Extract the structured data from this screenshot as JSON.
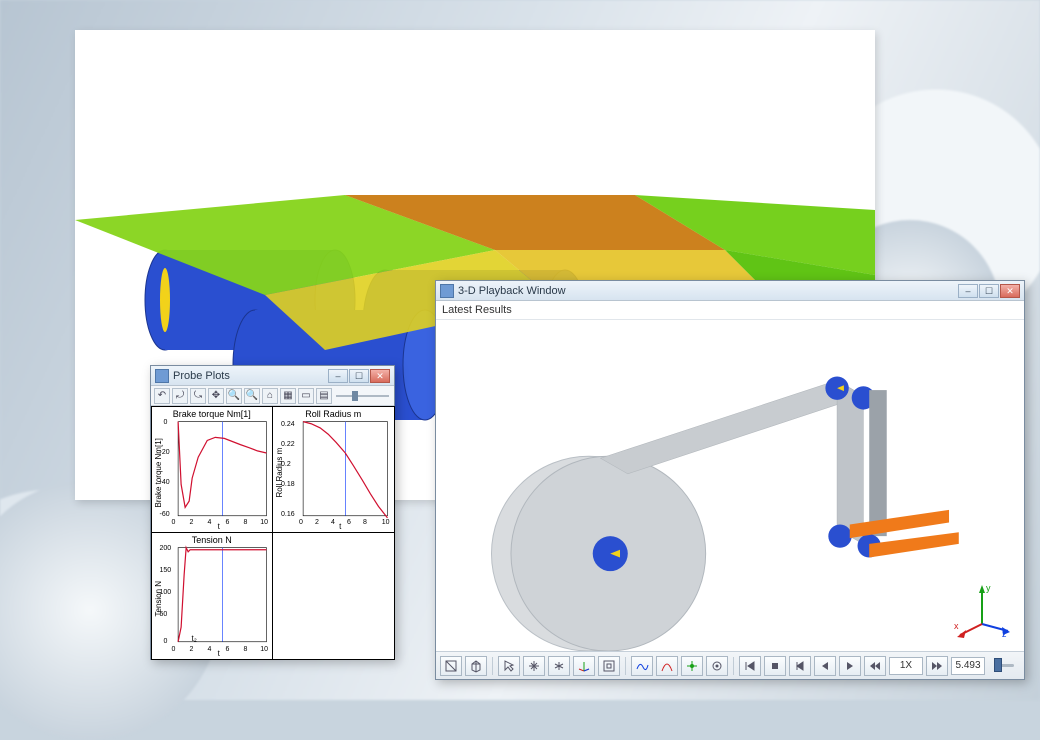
{
  "probe_window": {
    "title": "Probe Plots",
    "toolbar": [
      "↶",
      "⤾",
      "⤿",
      "✥",
      "🔍+",
      "🔍−",
      "⌂",
      "▦",
      "▭",
      "▤"
    ]
  },
  "playback_window": {
    "title": "3-D Playback Window",
    "subtitle": "Latest Results",
    "readout_speed": "1X",
    "readout_time": "5.493",
    "gizmo": {
      "x": "x",
      "y": "y",
      "z": "z"
    }
  },
  "chart_data": [
    {
      "type": "line",
      "title": "Brake torque Nm[1]",
      "xlabel": "t",
      "ylabel": "Brake torque Nm[1]",
      "xlim": [
        0,
        10
      ],
      "ylim": [
        -60,
        0
      ],
      "xticks": [
        0,
        2,
        4,
        6,
        8,
        10
      ],
      "yticks": [
        -60,
        -40,
        -20,
        0
      ],
      "series": [
        {
          "name": "torque",
          "color": "#d01030",
          "x": [
            0,
            0.4,
            0.8,
            1.2,
            1.5,
            2,
            3,
            4,
            5,
            6,
            7,
            8,
            9,
            10
          ],
          "y": [
            0,
            -40,
            -55,
            -50,
            -35,
            -22,
            -12,
            -10,
            -11,
            -13,
            -15,
            -17,
            -19,
            -20
          ]
        }
      ],
      "marker_x": 5
    },
    {
      "type": "line",
      "title": "Roll Radius m",
      "xlabel": "t",
      "ylabel": "Roll Radius m",
      "xlim": [
        0,
        10
      ],
      "ylim": [
        0.15,
        0.25
      ],
      "xticks": [
        0,
        2,
        4,
        6,
        8,
        10
      ],
      "yticks": [
        0.16,
        0.18,
        0.2,
        0.22,
        0.24
      ],
      "series": [
        {
          "name": "radius",
          "color": "#d01030",
          "x": [
            0,
            1,
            2,
            3,
            4,
            5,
            6,
            7,
            8,
            9,
            10
          ],
          "y": [
            0.25,
            0.248,
            0.244,
            0.238,
            0.23,
            0.22,
            0.207,
            0.192,
            0.178,
            0.164,
            0.152
          ]
        }
      ],
      "marker_x": 5
    },
    {
      "type": "line",
      "title": "Tension N",
      "xlabel": "t",
      "ylabel": "Tension N",
      "xlim": [
        0,
        10
      ],
      "ylim": [
        0,
        210
      ],
      "xticks": [
        0,
        2,
        4,
        6,
        8,
        10
      ],
      "yticks": [
        0,
        50,
        100,
        150,
        200
      ],
      "series": [
        {
          "name": "tension",
          "color": "#d01030",
          "x": [
            0,
            0.3,
            0.6,
            0.8,
            1,
            1.2,
            1.5,
            2,
            4,
            6,
            8,
            10
          ],
          "y": [
            0,
            30,
            140,
            205,
            195,
            200,
            200,
            200,
            200,
            200,
            200,
            200
          ]
        }
      ],
      "marker_x": 5,
      "annotation": "t₂"
    }
  ]
}
